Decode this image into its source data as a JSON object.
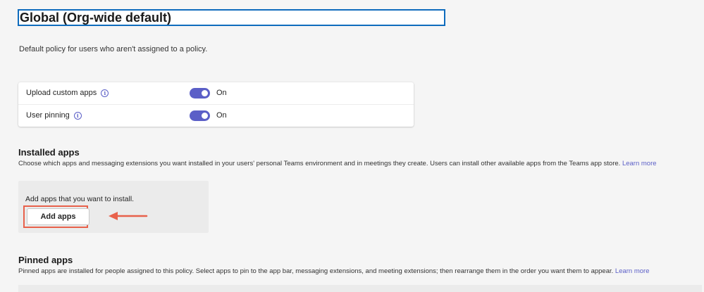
{
  "header": {
    "title": "Global (Org-wide default)",
    "subtitle": "Default policy for users who aren't assigned to a policy."
  },
  "settings": [
    {
      "label": "Upload custom apps",
      "state": "On",
      "enabled": true
    },
    {
      "label": "User pinning",
      "state": "On",
      "enabled": true
    }
  ],
  "installed_apps": {
    "heading": "Installed apps",
    "description": "Choose which apps and messaging extensions you want installed in your users' personal Teams environment and in meetings they create. Users can install other available apps from the Teams app store.",
    "learn_more": "Learn more",
    "panel_text": "Add apps that you want to install.",
    "add_button": "Add apps"
  },
  "pinned_apps": {
    "heading": "Pinned apps",
    "description": "Pinned apps are installed for people assigned to this policy. Select apps to pin to the app bar, messaging extensions, and meeting extensions; then rearrange them in the order you want them to appear.",
    "learn_more": "Learn more"
  },
  "colors": {
    "accent": "#5b5fc7",
    "focus_border": "#0f6cbd",
    "annotation": "#e8614b"
  }
}
